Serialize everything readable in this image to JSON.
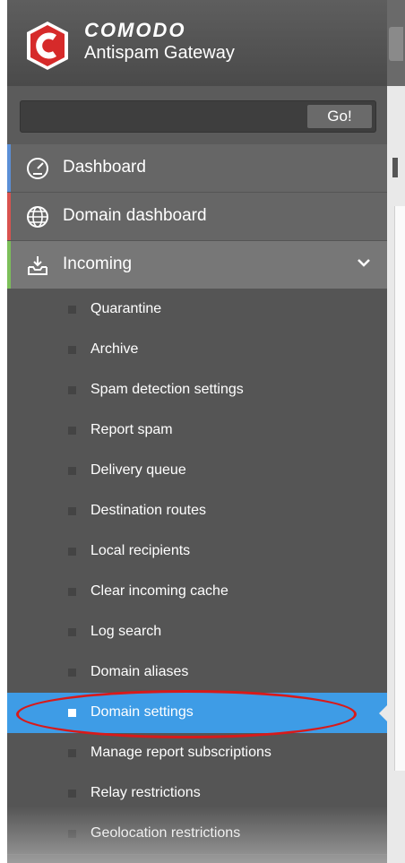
{
  "header": {
    "brand_name": "COMODO",
    "product_name": "Antispam Gateway"
  },
  "search": {
    "placeholder": "",
    "value": "",
    "go_label": "Go!"
  },
  "nav": {
    "dashboard": "Dashboard",
    "domain_dashboard": "Domain dashboard",
    "incoming": "Incoming",
    "incoming_items": [
      "Quarantine",
      "Archive",
      "Spam detection settings",
      "Report spam",
      "Delivery queue",
      "Destination routes",
      "Local recipients",
      "Clear incoming cache",
      "Log search",
      "Domain aliases",
      "Domain settings",
      "Manage report subscriptions",
      "Relay restrictions",
      "Geolocation restrictions"
    ],
    "active_item": "Domain settings"
  },
  "colors": {
    "active": "#3e9ce6",
    "callout": "#d81a1a",
    "accent_dashboard": "#5b8fd6",
    "accent_domain": "#d9534f",
    "accent_incoming": "#7cbf5a"
  }
}
